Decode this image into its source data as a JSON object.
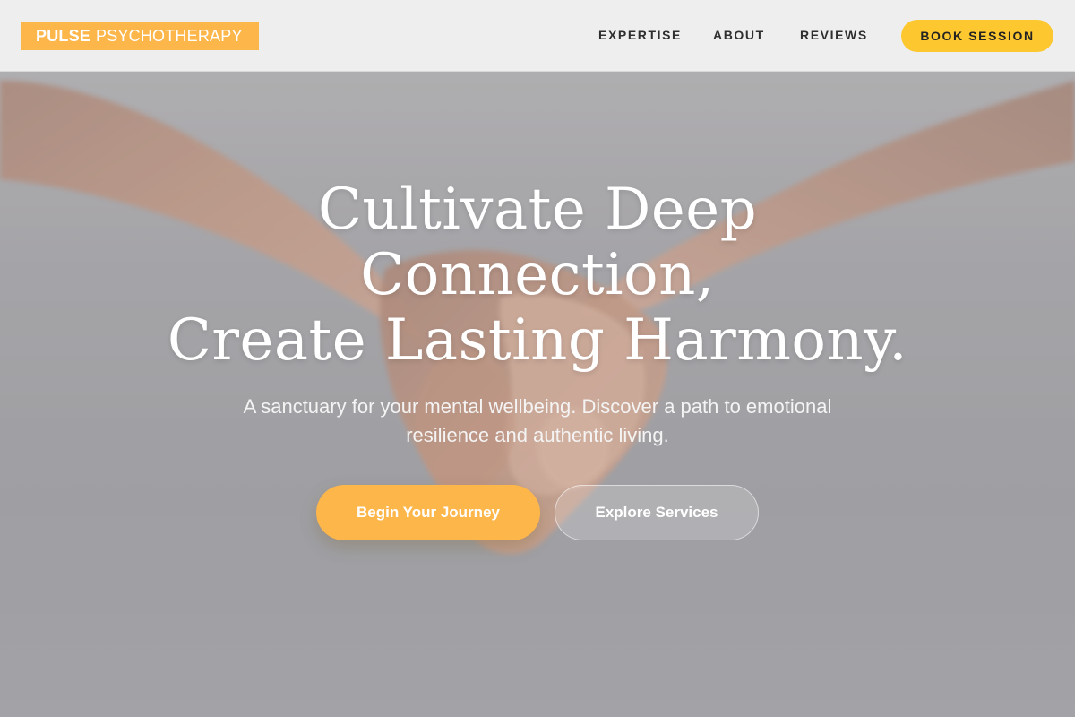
{
  "brand": {
    "name_bold": "PULSE",
    "name_rest": "PSYCHOTHERAPY"
  },
  "nav": {
    "links": [
      "EXPERTISE",
      "ABOUT",
      "REVIEWS"
    ],
    "cta": "BOOK SESSION"
  },
  "hero": {
    "headline_lines": [
      "Cultivate Deep",
      "Connection,",
      "Create Lasting Harmony."
    ],
    "subtitle": "A sanctuary for your mental wellbeing. Discover a path to emotional resilience and authentic living.",
    "primary_cta": "Begin Your Journey",
    "secondary_cta": "Explore Services",
    "background_image": "hands-holding-photo"
  },
  "colors": {
    "accent_orange": "#fdb64a",
    "accent_yellow": "#fcc72f",
    "header_bg": "#f0f0f0",
    "text_dark": "#2e2e30",
    "text_light": "#ffffff"
  }
}
